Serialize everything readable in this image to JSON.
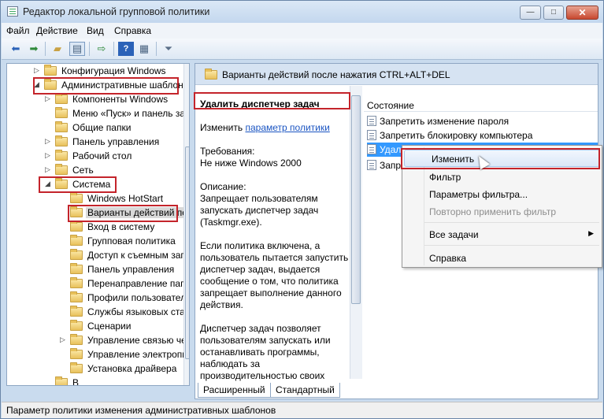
{
  "window": {
    "title": "Редактор локальной групповой политики",
    "min": "—",
    "max": "□",
    "close": "✕"
  },
  "menu": [
    "Файл",
    "Действие",
    "Вид",
    "Справка"
  ],
  "tree": [
    {
      "label": "Конфигурация Windows",
      "arrow": "▷"
    },
    {
      "label": "Административные шаблоны",
      "arrow": "◢"
    },
    {
      "label": "Компоненты Windows",
      "arrow": "▷"
    },
    {
      "label": "Меню «Пуск» и панель задач",
      "arrow": ""
    },
    {
      "label": "Общие папки",
      "arrow": ""
    },
    {
      "label": "Панель управления",
      "arrow": "▷"
    },
    {
      "label": "Рабочий стол",
      "arrow": "▷"
    },
    {
      "label": "Сеть",
      "arrow": "▷"
    },
    {
      "label": "Система",
      "arrow": "◢"
    },
    {
      "label": "Windows HotStart",
      "arrow": ""
    },
    {
      "label": "Варианты действий после",
      "arrow": ""
    },
    {
      "label": "Вход в систему",
      "arrow": ""
    },
    {
      "label": "Групповая политика",
      "arrow": ""
    },
    {
      "label": "Доступ к съемным запоминающим",
      "arrow": ""
    },
    {
      "label": "Панель управления",
      "arrow": ""
    },
    {
      "label": "Перенаправление папок",
      "arrow": ""
    },
    {
      "label": "Профили пользователей",
      "arrow": ""
    },
    {
      "label": "Службы языковых стандартов",
      "arrow": ""
    },
    {
      "label": "Сценарии",
      "arrow": ""
    },
    {
      "label": "Управление связью через Интернет",
      "arrow": "▷"
    },
    {
      "label": "Управление электропитанием",
      "arrow": ""
    },
    {
      "label": "Установка драйвера",
      "arrow": ""
    },
    {
      "label": "В",
      "arrow": ""
    }
  ],
  "right": {
    "header": "Варианты действий после нажатия CTRL+ALT+DEL",
    "policy_title": "Удалить диспетчер задач",
    "edit_prefix": "Изменить",
    "edit_link": "параметр политики",
    "requirements": "Требования:\nНе ниже Windows 2000",
    "description": "Описание:\nЗапрещает пользователям запускать диспетчер задач (Taskmgr.exe).",
    "para2": "Если политика включена, а пользователь пытается запустить диспетчер задач, выдается сообщение о том, что политика запрещает выполнение данного действия.",
    "para3": "Диспетчер задач позволяет пользователям запускать или останавливать программы, наблюдать за производительностью своих",
    "state_header": "Состояние",
    "items": [
      "Запретить изменение пароля",
      "Запретить блокировку компьютера",
      "Удалить диспетчер задач",
      "Запретить выход из системы"
    ]
  },
  "tabs": [
    "Расширенный",
    "Стандартный"
  ],
  "context_menu": {
    "items": [
      "Изменить",
      "Фильтр",
      "Параметры фильтра...",
      "Повторно применить фильтр",
      "Все задачи",
      "Справка"
    ],
    "submenu_arrow": "▶"
  },
  "status": "Параметр политики изменения административных шаблонов",
  "colors": {
    "highlight": "#3399ff",
    "annotation_red": "#c4242b",
    "link": "#1a54c2"
  },
  "icons": [
    "back-arrow-icon",
    "forward-arrow-icon",
    "up-folder-icon",
    "show-hide-tree-icon",
    "export-list-icon",
    "help-icon",
    "properties-icon",
    "filter-icon"
  ]
}
